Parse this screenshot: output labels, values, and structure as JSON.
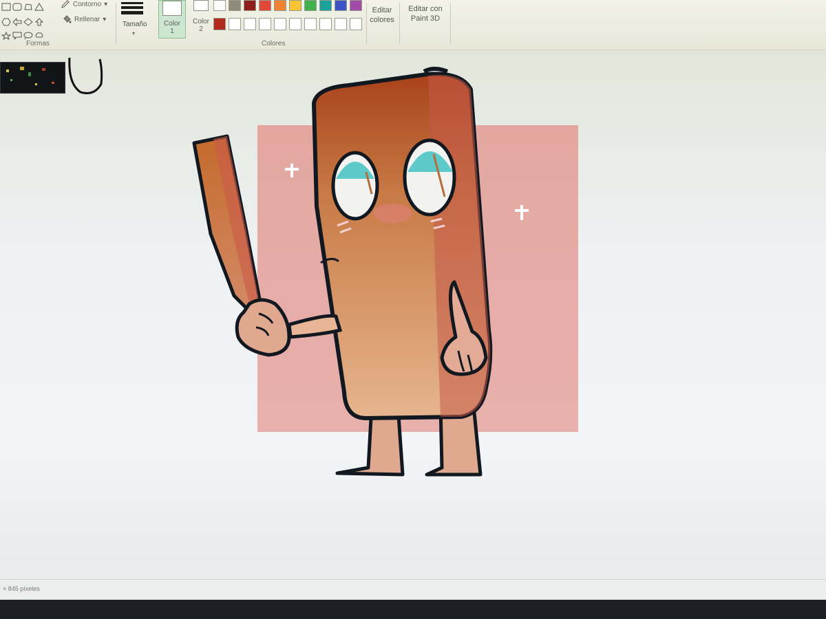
{
  "ribbon": {
    "shapes_group_label": "Formas",
    "outline_label": "Contorno",
    "fill_label": "Rellenar",
    "size_label": "Tamaño",
    "color1_label": "Color",
    "color1_number": "1",
    "color2_label": "Color",
    "color2_number": "2",
    "colors_group_label": "Colores",
    "edit_colors_line1": "Editar",
    "edit_colors_line2": "colores",
    "edit_paint3d_line1": "Editar con",
    "edit_paint3d_line2": "Paint 3D"
  },
  "palette_colors": {
    "row1": [
      "#ffffff",
      "#8f8a7a",
      "#8f1f1a",
      "#e2473a",
      "#f0822f",
      "#f6c436",
      "#3fb24c",
      "#1aa39c",
      "#3e53c4",
      "#a24aa8"
    ],
    "row2": [
      "#b22a1e",
      "#ffffff",
      "#ffffff",
      "#ffffff",
      "#ffffff",
      "#ffffff",
      "#ffffff",
      "#ffffff",
      "#ffffff",
      "#ffffff"
    ]
  },
  "status": {
    "size_text": "× 845 píxeles"
  }
}
